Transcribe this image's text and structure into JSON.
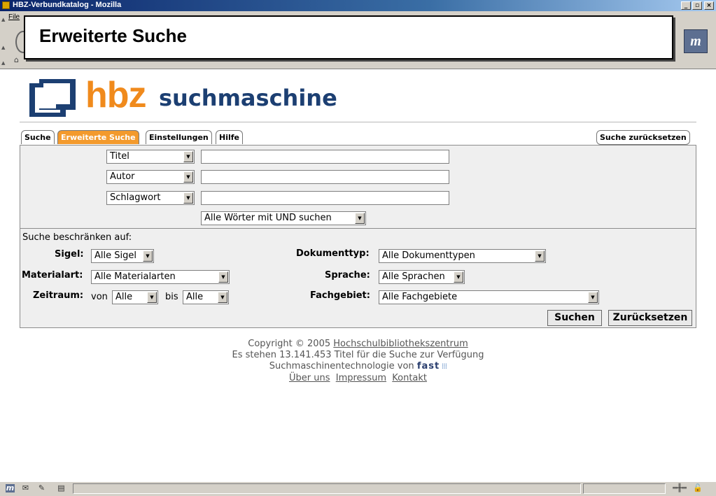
{
  "window": {
    "title": "HBZ-Verbundkatalog - Mozilla",
    "menu_file": "File"
  },
  "overlay": {
    "title": "Erweiterte Suche"
  },
  "logo": {
    "brand": "hbz",
    "product": "suchmaschine"
  },
  "tabs": [
    {
      "label": "Suche",
      "active": false
    },
    {
      "label": "Erweiterte Suche",
      "active": true
    },
    {
      "label": "Einstellungen",
      "active": false
    },
    {
      "label": "Hilfe",
      "active": false
    }
  ],
  "reset_search_label": "Suche zurücksetzen",
  "search_rows": [
    {
      "field": "Titel",
      "value": ""
    },
    {
      "field": "Autor",
      "value": ""
    },
    {
      "field": "Schlagwort",
      "value": ""
    }
  ],
  "combine_mode": "Alle Wörter mit UND suchen",
  "restrict": {
    "heading": "Suche beschränken auf:",
    "sigel": {
      "label": "Sigel:",
      "value": "Alle Sigel"
    },
    "materialart": {
      "label": "Materialart:",
      "value": "Alle Materialarten"
    },
    "zeitraum": {
      "label": "Zeitraum:",
      "von": "von",
      "von_value": "Alle",
      "bis": "bis",
      "bis_value": "Alle"
    },
    "dokumenttyp": {
      "label": "Dokumenttyp:",
      "value": "Alle Dokumenttypen"
    },
    "sprache": {
      "label": "Sprache:",
      "value": "Alle Sprachen"
    },
    "fachgebiet": {
      "label": "Fachgebiet:",
      "value": "Alle Fachgebiete"
    }
  },
  "buttons": {
    "search": "Suchen",
    "reset": "Zurücksetzen"
  },
  "footer": {
    "copyright": "Copyright © 2005",
    "org": "Hochschulbibliothekszentrum",
    "stats": "Es stehen 13.141.453 Titel für die Suche zur Verfügung",
    "tech": "Suchmaschinentechnologie von",
    "tech_brand": "fast",
    "links": [
      "Über uns",
      "Impressum",
      "Kontakt"
    ]
  },
  "colors": {
    "accent": "#f39a2d",
    "brand_blue": "#1c3f72",
    "brand_orange": "#f08a1c"
  },
  "icons": [
    "app-icon",
    "home-icon",
    "throbber-icon",
    "mail-icon",
    "composer-icon",
    "addressbook-icon",
    "lock-icon"
  ]
}
